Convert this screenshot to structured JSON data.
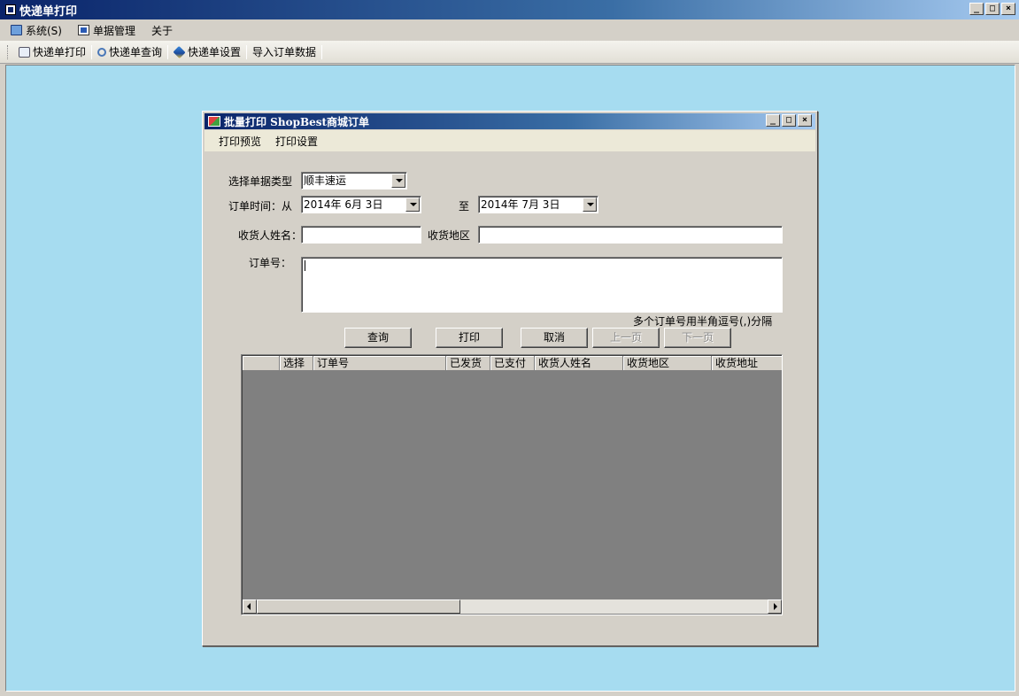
{
  "app": {
    "title": "快递单打印"
  },
  "window_controls": {
    "min": "_",
    "max": "□",
    "close": "×"
  },
  "menubar": {
    "items": [
      {
        "label": "系统(S)",
        "icon": "monitor-icon"
      },
      {
        "label": "单据管理",
        "icon": "document-icon"
      },
      {
        "label": "关于"
      }
    ]
  },
  "toolbar": {
    "items": [
      {
        "label": "快递单打印",
        "icon": "print-icon"
      },
      {
        "label": "快递单查询",
        "icon": "search-icon"
      },
      {
        "label": "快递单设置",
        "icon": "settings-cube-icon"
      },
      {
        "label": "导入订单数据"
      }
    ]
  },
  "child": {
    "title": "批量打印 ShopBest商城订单",
    "menu": [
      "打印预览",
      "打印设置"
    ],
    "form": {
      "doc_type_label": "选择单据类型",
      "doc_type_value": "顺丰速运",
      "order_time_label": "订单时间：从",
      "date_from": "2014年 6月 3日",
      "to_label": "至",
      "date_to": "2014年 7月 3日",
      "recipient_label": "收货人姓名：",
      "recipient_value": "",
      "region_label": "收货地区",
      "region_value": "",
      "order_no_label": "订单号：",
      "order_no_value": "",
      "hint": "多个订单号用半角逗号(,)分隔"
    },
    "buttons": {
      "query": "查询",
      "print": "打印",
      "cancel": "取消",
      "prev": "上一页",
      "next": "下一页"
    },
    "grid": {
      "columns": [
        "",
        "选择",
        "订单号",
        "已发货",
        "已支付",
        "收货人姓名",
        "收货地区",
        "收货地址"
      ]
    }
  }
}
